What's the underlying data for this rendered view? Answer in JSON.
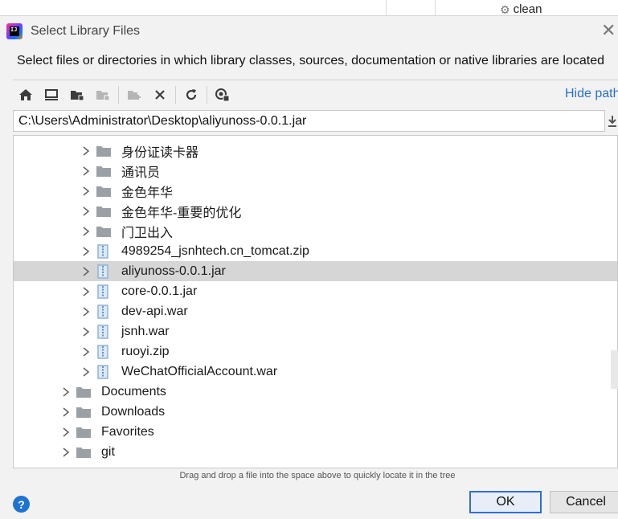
{
  "background": {
    "clean_label": "clean"
  },
  "dialog": {
    "title": "Select Library Files",
    "description": "Select files or directories in which library classes, sources, documentation or native libraries are located",
    "hide_path_label": "Hide path",
    "path_value": "C:\\Users\\Administrator\\Desktop\\aliyunoss-0.0.1.jar",
    "drag_hint": "Drag and drop a file into the space above to quickly locate it in the tree",
    "ok_label": "OK",
    "cancel_label": "Cancel",
    "help_label": "?"
  },
  "toolbar": {
    "icons": [
      "home-icon",
      "desktop-icon",
      "project-folder-icon",
      "module-folder-icon",
      "new-folder-icon",
      "delete-icon",
      "refresh-icon",
      "show-hidden-icon"
    ]
  },
  "tree": {
    "items": [
      {
        "label": "身份证读卡器",
        "kind": "folder",
        "level": 2
      },
      {
        "label": "通讯员",
        "kind": "folder",
        "level": 2
      },
      {
        "label": "金色年华",
        "kind": "folder",
        "level": 2
      },
      {
        "label": "金色年华-重要的优化",
        "kind": "folder",
        "level": 2
      },
      {
        "label": "门卫出入",
        "kind": "folder",
        "level": 2
      },
      {
        "label": "4989254_jsnhtech.cn_tomcat.zip",
        "kind": "archive",
        "level": 2
      },
      {
        "label": "aliyunoss-0.0.1.jar",
        "kind": "archive",
        "level": 2,
        "selected": true
      },
      {
        "label": "core-0.0.1.jar",
        "kind": "archive",
        "level": 2
      },
      {
        "label": "dev-api.war",
        "kind": "archive",
        "level": 2
      },
      {
        "label": "jsnh.war",
        "kind": "archive",
        "level": 2
      },
      {
        "label": "ruoyi.zip",
        "kind": "archive",
        "level": 2
      },
      {
        "label": "WeChatOfficialAccount.war",
        "kind": "archive",
        "level": 2
      },
      {
        "label": "Documents",
        "kind": "folder",
        "level": 1
      },
      {
        "label": "Downloads",
        "kind": "folder",
        "level": 1
      },
      {
        "label": "Favorites",
        "kind": "folder",
        "level": 1
      },
      {
        "label": "git",
        "kind": "folder",
        "level": 1
      }
    ]
  },
  "colors": {
    "accent": "#2a70c8",
    "selection": "#d6d6d6",
    "folder": "#9aa0a6",
    "archive": "#8fb4d9"
  }
}
